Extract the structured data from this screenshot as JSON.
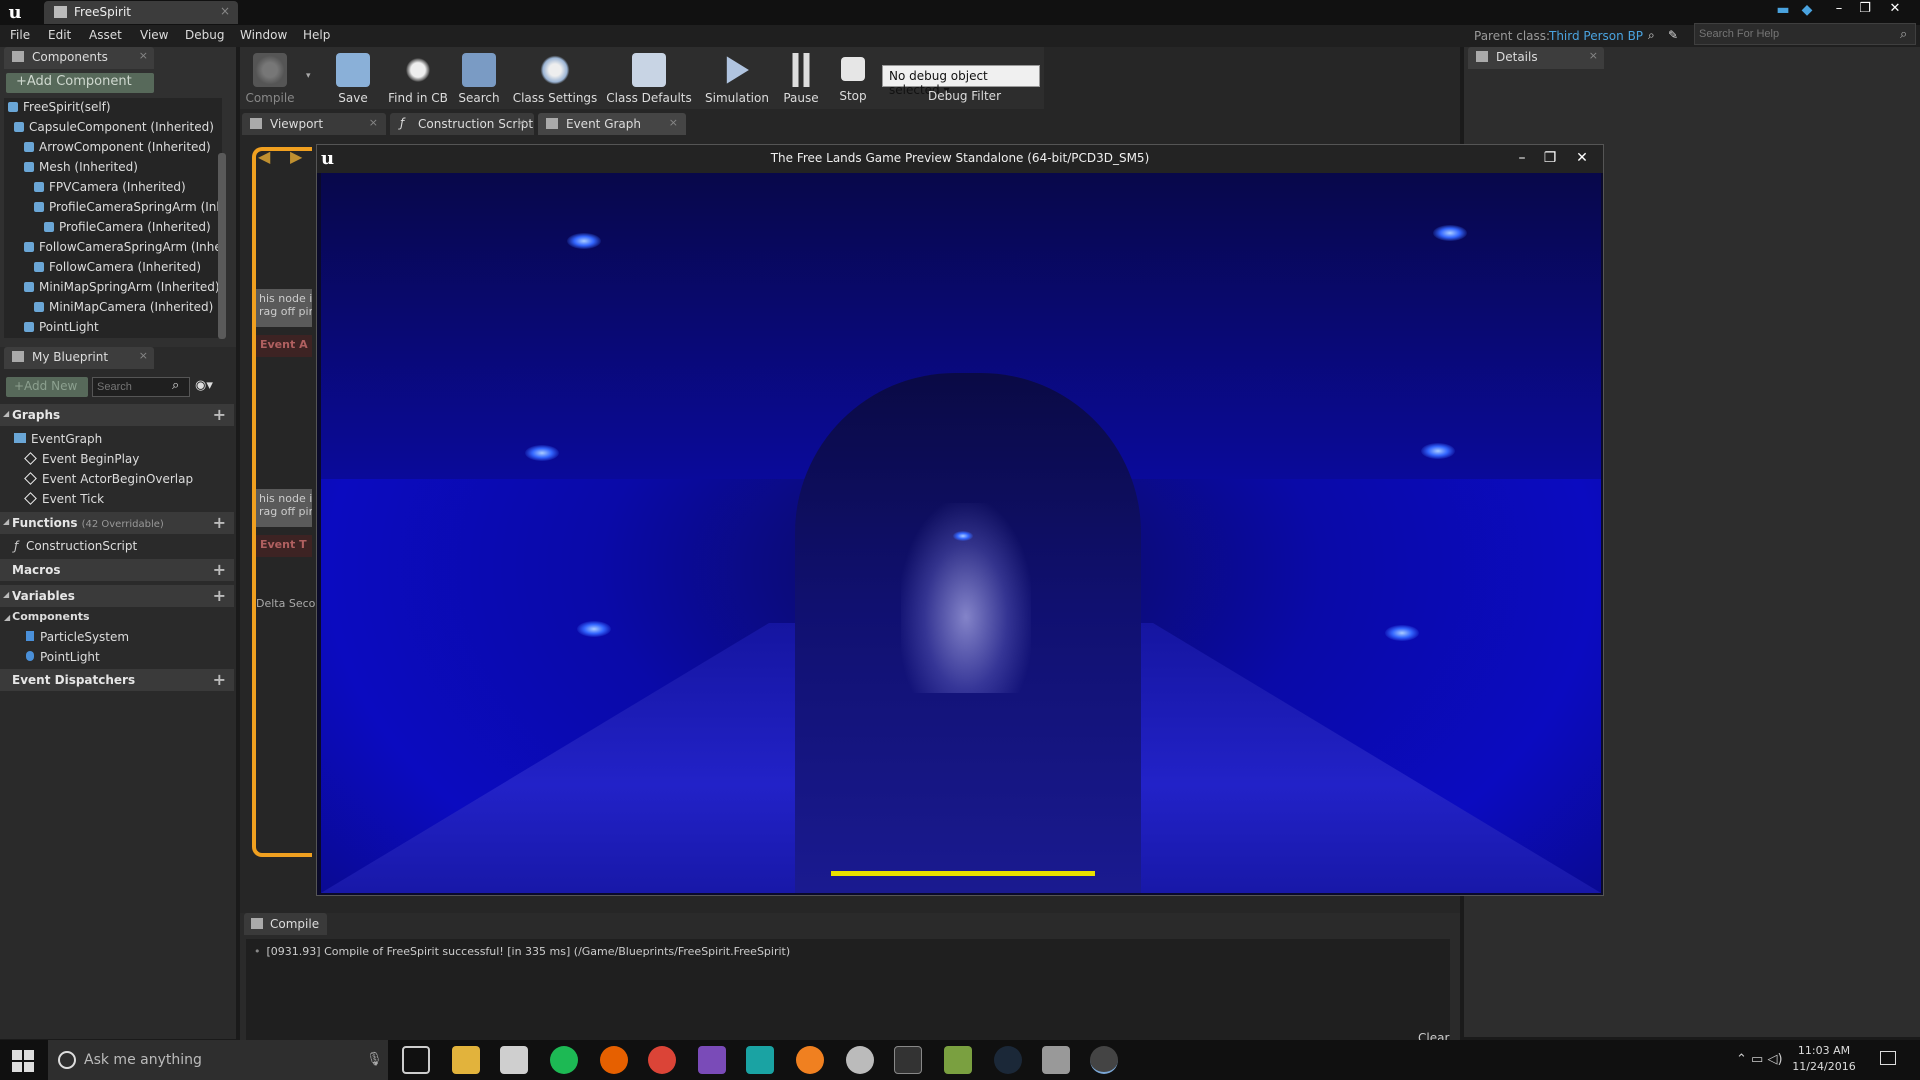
{
  "titlebar": {
    "logo": "u",
    "tab_label": "FreeSpirit",
    "close_glyph": "×",
    "minimize_glyph": "–",
    "maximize_glyph": "❐",
    "win_close_glyph": "✕"
  },
  "menu": {
    "items": [
      "File",
      "Edit",
      "Asset",
      "View",
      "Debug",
      "Window",
      "Help"
    ],
    "parent_class_label": "Parent class:",
    "parent_class_value": "Third Person BP",
    "search_placeholder": "Search For Help"
  },
  "components_panel": {
    "tab_label": "Components",
    "add_button": "+Add Component",
    "tree": [
      "FreeSpirit(self)",
      "CapsuleComponent (Inherited)",
      "ArrowComponent (Inherited)",
      "Mesh (Inherited)",
      "FPVCamera (Inherited)",
      "ProfileCameraSpringArm (Inhe",
      "ProfileCamera (Inherited)",
      "FollowCameraSpringArm (Inheri",
      "FollowCamera (Inherited)",
      "MiniMapSpringArm (Inherited)",
      "MiniMapCamera (Inherited)",
      "PointLight"
    ]
  },
  "my_blueprint": {
    "tab_label": "My Blueprint",
    "add_new": "+Add New",
    "search_placeholder": "Search",
    "sections": {
      "graphs": "Graphs",
      "functions": "Functions",
      "functions_sub": "(42 Overridable)",
      "macros": "Macros",
      "variables": "Variables",
      "components": "Components",
      "event_dispatchers": "Event Dispatchers"
    },
    "graph_items": [
      "EventGraph",
      "Event BeginPlay",
      "Event ActorBeginOverlap",
      "Event Tick"
    ],
    "function_items": [
      "ConstructionScript"
    ],
    "component_items": [
      "ParticleSystem",
      "PointLight"
    ]
  },
  "toolbar": {
    "compile": "Compile",
    "save": "Save",
    "find_in_cb": "Find in CB",
    "search": "Search",
    "class_settings": "Class Settings",
    "class_defaults": "Class Defaults",
    "simulation": "Simulation",
    "pause": "Pause",
    "stop": "Stop",
    "debug_object": "No debug object selected",
    "debug_filter": "Debug Filter"
  },
  "editor_tabs": {
    "viewport": "Viewport",
    "construction_script": "Construction Script",
    "event_graph": "Event Graph"
  },
  "graph_fragments": {
    "node1_line1": "his node is",
    "node1_line2": "rag off pin",
    "event1": "Event A",
    "node2_line1": "his node is",
    "node2_line2": "rag off pin",
    "event2": "Event T",
    "delta": "Delta Secon"
  },
  "compiler": {
    "tab_label": "Compile",
    "log_line": "[0931.93] Compile of FreeSpirit successful! [in 335 ms] (/Game/Blueprints/FreeSpirit.FreeSpirit)",
    "clear": "Clear"
  },
  "details": {
    "tab_label": "Details"
  },
  "game_window": {
    "title": "The Free Lands Game Preview Standalone (64-bit/PCD3D_SM5)",
    "loading_progress": 0.25,
    "accent": "#e8e000"
  },
  "taskbar": {
    "search_text": "Ask me anything",
    "time": "11:03 AM",
    "date": "11/24/2016"
  }
}
